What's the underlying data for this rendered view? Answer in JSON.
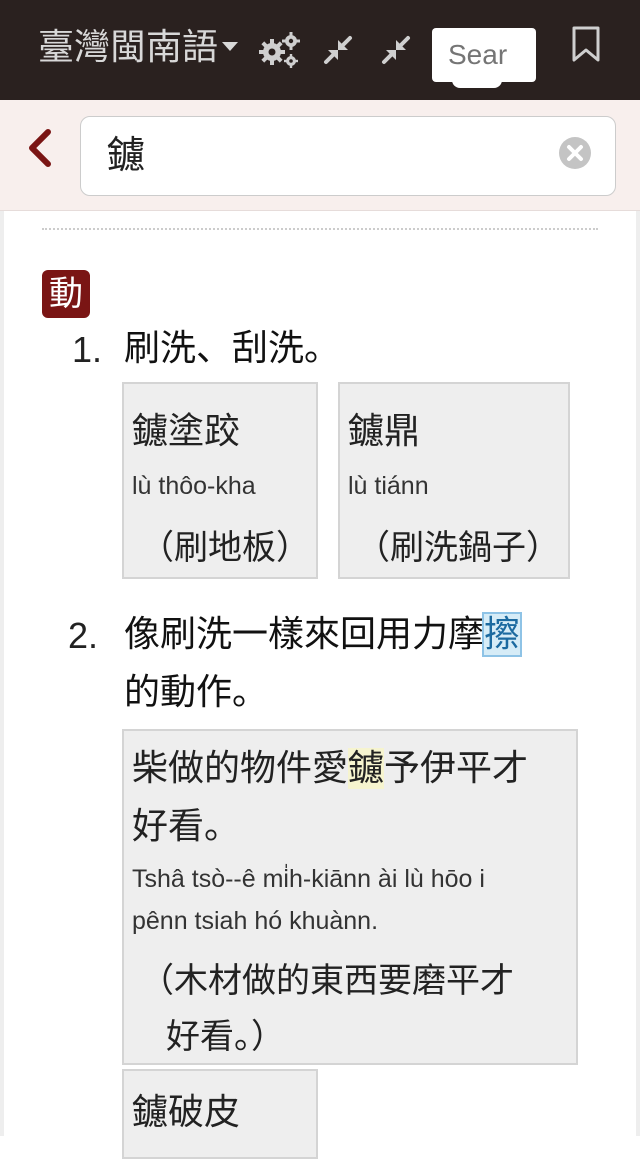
{
  "header": {
    "app_title": "臺灣閩南語",
    "search_placeholder": "Sear"
  },
  "query": {
    "value": "鑢"
  },
  "entry": {
    "part_of_speech": "動",
    "definitions": [
      {
        "number": "1.",
        "text": "刷洗、刮洗。",
        "examples": [
          {
            "hanji": "鑢塗跤",
            "romanization": "lù thôo-kha",
            "translation": "（刷地板）"
          },
          {
            "hanji": "鑢鼎",
            "romanization": "lù tiánn",
            "translation": "（刷洗鍋子）"
          }
        ]
      },
      {
        "number": "2.",
        "text_before": "像刷洗一樣來回用力摩",
        "text_highlight": "擦",
        "text_line2": "的動作。",
        "examples": [
          {
            "hanji_before": "柴做的物件愛",
            "hanji_highlight": "鑢",
            "hanji_after": "予伊平才",
            "hanji_line2": "好看。",
            "romanization_line1": "Tshâ tsò--ê mi̍h-kiānn ài lù hōo i",
            "romanization_line2": "pênn tsiah hó khuànn.",
            "translation_line1": "（木材做的東西要磨平才",
            "translation_line2": "好看。）"
          },
          {
            "hanji": "鑢破皮"
          }
        ]
      }
    ]
  },
  "icons": {
    "settings": "gears-icon",
    "collapse1": "collapse-arrows-icon",
    "collapse2": "collapse-arrows-icon",
    "bookmark": "bookmark-icon",
    "back": "chevron-left-icon",
    "clear": "clear-circle-icon"
  },
  "colors": {
    "topbar_bg": "#2a211f",
    "badge_bg": "#7a1514",
    "back_arrow": "#7a1514",
    "subbar_bg": "#f8efed"
  }
}
